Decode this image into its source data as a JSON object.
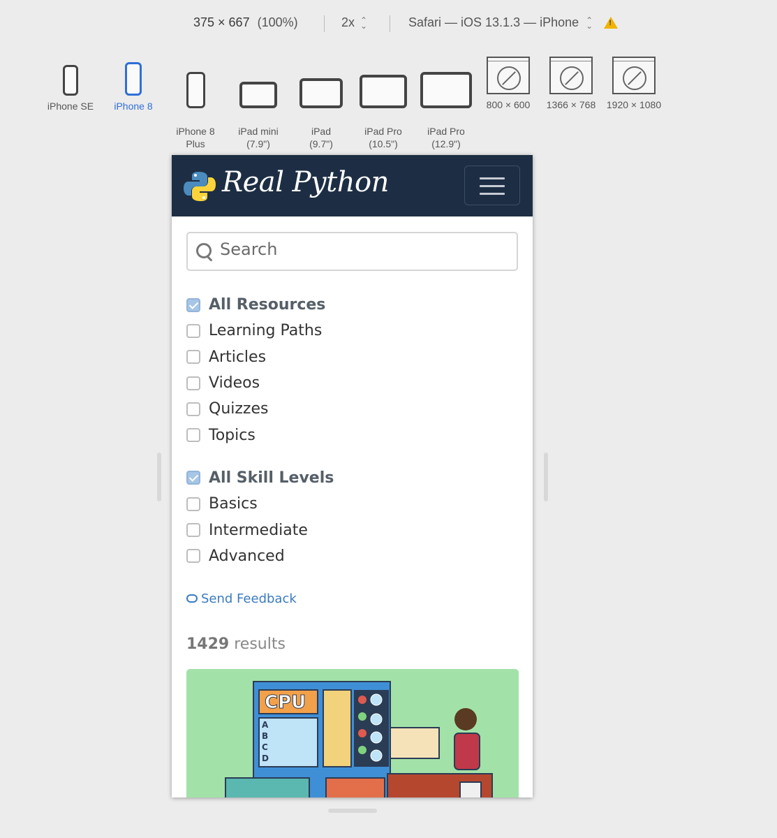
{
  "toolbar": {
    "dimensions": "375 × 667",
    "zoom": "(100%)",
    "scale": "2x",
    "browser": "Safari — iOS 13.1.3 — iPhone"
  },
  "devices": [
    {
      "label": "iPhone SE"
    },
    {
      "label": "iPhone 8",
      "active": true
    },
    {
      "label": "iPhone 8\nPlus"
    },
    {
      "label": "iPad mini\n(7.9\")"
    },
    {
      "label": "iPad\n(9.7\")"
    },
    {
      "label": "iPad Pro\n(10.5\")"
    },
    {
      "label": "iPad Pro\n(12.9\")"
    },
    {
      "label": "800 × 600"
    },
    {
      "label": "1366 × 768"
    },
    {
      "label": "1920 × 1080"
    }
  ],
  "site": {
    "brand": "Real Python",
    "search_placeholder": "Search",
    "resources": {
      "items": [
        {
          "label": "All Resources",
          "checked": true
        },
        {
          "label": "Learning Paths",
          "checked": false
        },
        {
          "label": "Articles",
          "checked": false
        },
        {
          "label": "Videos",
          "checked": false
        },
        {
          "label": "Quizzes",
          "checked": false
        },
        {
          "label": "Topics",
          "checked": false
        }
      ]
    },
    "skills": {
      "items": [
        {
          "label": "All Skill Levels",
          "checked": true
        },
        {
          "label": "Basics",
          "checked": false
        },
        {
          "label": "Intermediate",
          "checked": false
        },
        {
          "label": "Advanced",
          "checked": false
        }
      ]
    },
    "feedback": "Send Feedback",
    "results_count": "1429",
    "results_label": "results",
    "hero_text": [
      "CPU",
      "A",
      "B",
      "C",
      "D"
    ]
  },
  "colors": {
    "nav_bg": "#1d2e44",
    "link": "#3b7bbf",
    "active_device": "#2f6fd8",
    "hero_bg": "#a2e2a8"
  }
}
